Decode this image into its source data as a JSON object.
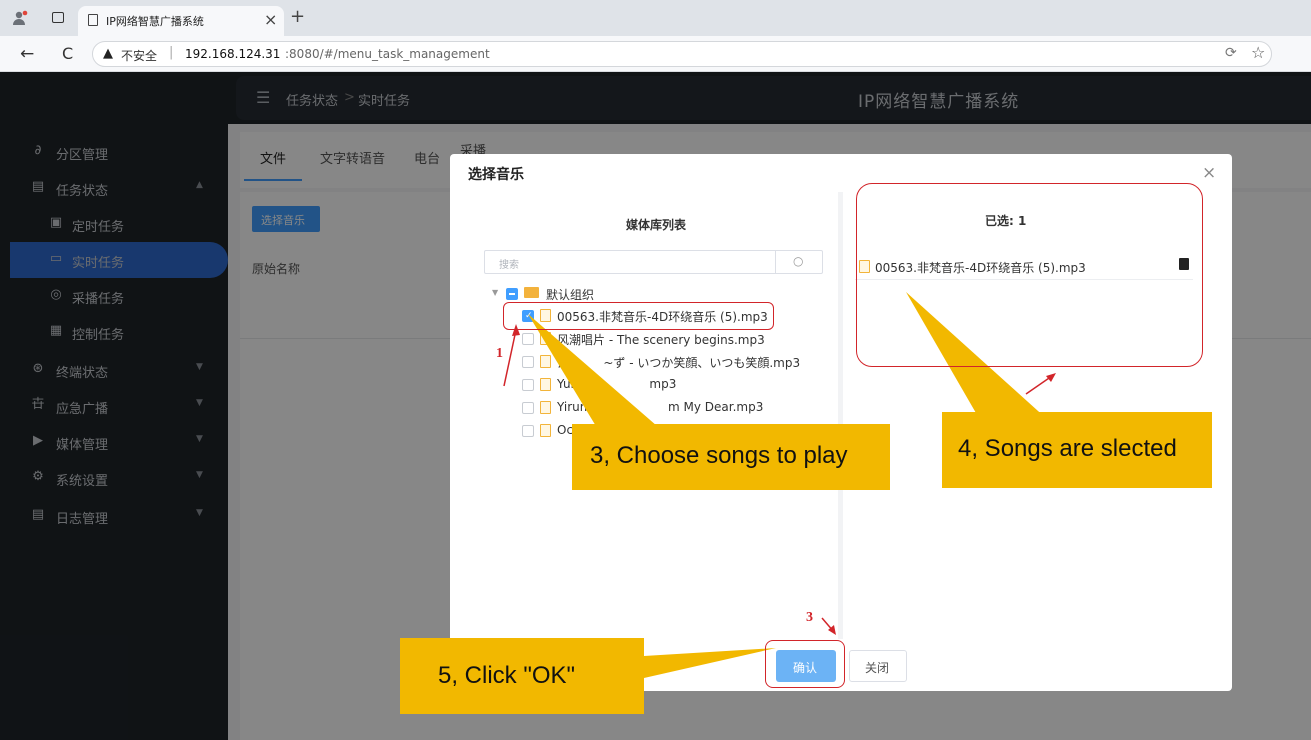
{
  "browser": {
    "tab_title": "IP网络智慧广播系统",
    "tab_close": "×",
    "new_tab": "+",
    "back": "←",
    "reload": "C",
    "security": "不安全",
    "url_host": "192.168.124.31",
    "url_rest": ":8080/#/menu_task_management"
  },
  "header": {
    "breadcrumb_root": "任务状态",
    "breadcrumb_sep": ">",
    "breadcrumb_current": "实时任务",
    "app_title": "IP网络智慧广播系统"
  },
  "sidebar": {
    "items": [
      {
        "label": "分区管理",
        "icon": "link-icon"
      },
      {
        "label": "任务状态",
        "icon": "task-icon"
      },
      {
        "label": "定时任务",
        "icon": "timer-icon"
      },
      {
        "label": "实时任务",
        "icon": "monitor-icon"
      },
      {
        "label": "采播任务",
        "icon": "record-icon"
      },
      {
        "label": "控制任务",
        "icon": "control-icon"
      },
      {
        "label": "终端状态",
        "icon": "terminal-icon"
      },
      {
        "label": "应急广播",
        "icon": "broadcast-icon"
      },
      {
        "label": "媒体管理",
        "icon": "media-icon"
      },
      {
        "label": "系统设置",
        "icon": "gear-icon"
      },
      {
        "label": "日志管理",
        "icon": "log-icon"
      }
    ]
  },
  "main": {
    "tabs": [
      "文件",
      "文字转语音",
      "电台",
      "采播"
    ],
    "select_music_button": "选择音乐",
    "column_original_name": "原始名称"
  },
  "dialog": {
    "title": "选择音乐",
    "close": "×",
    "library_title": "媒体库列表",
    "search_placeholder": "搜索",
    "group_name": "默认组织",
    "files": [
      {
        "name": "00563.非梵音乐-4D环绕音乐 (5).mp3",
        "checked": true
      },
      {
        "name": "风潮唱片 - The scenery begins.mp3",
        "checked": false
      },
      {
        "name": "た         ~ず - いつか笑顔、いつも笑顔.mp3",
        "checked": false
      },
      {
        "name": "Yulia                 mp3",
        "checked": false
      },
      {
        "name": "Yiruma -                m My Dear.mp3",
        "checked": false
      },
      {
        "name": "Oc",
        "checked": false
      }
    ],
    "selected_title": "已选: 1",
    "selected_files": [
      "00563.非梵音乐-4D环绕音乐 (5).mp3"
    ],
    "confirm_button": "确认",
    "close_button": "关闭"
  },
  "annotations": {
    "step3_text": "3, Choose songs to play",
    "step4_text": "4, Songs are slected",
    "step5_text": "5, Click \"OK\"",
    "mark_1": "1",
    "mark_3": "3"
  },
  "colors": {
    "sidebar_bg": "#1f2429",
    "active_item": "#2f6bd0",
    "primary": "#409eff",
    "callout": "#f2b800",
    "annotation_red": "#d2252a"
  }
}
